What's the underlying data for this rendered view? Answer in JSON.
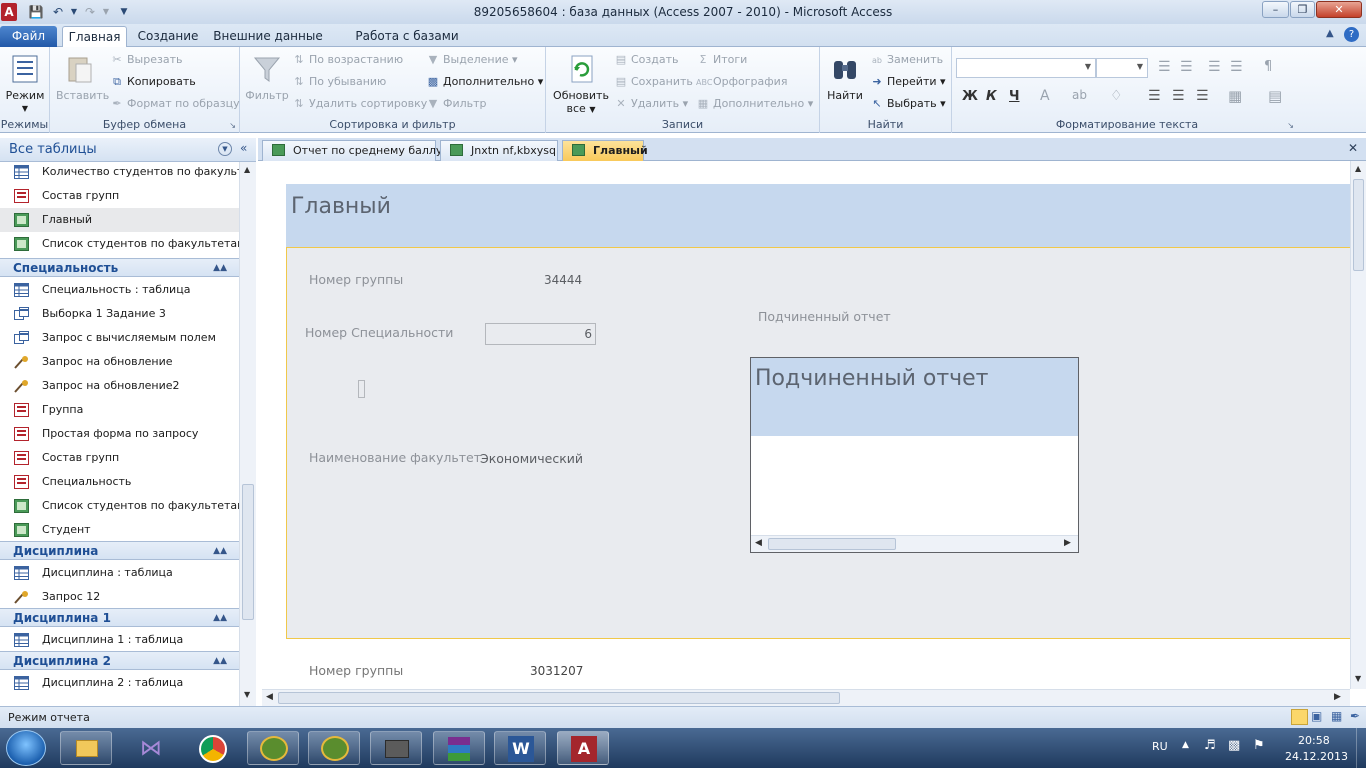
{
  "window": {
    "title": "89205658604 : база данных (Access 2007 - 2010)  -  Microsoft Access"
  },
  "ribbon_tabs": [
    "Файл",
    "Главная",
    "Создание",
    "Внешние данные",
    "Работа с базами данных"
  ],
  "ribbon": {
    "views": {
      "mode": "Режим",
      "group": "Режимы"
    },
    "clipboard": {
      "paste": "Вставить",
      "cut": "Вырезать",
      "copy": "Копировать",
      "format_painter": "Формат по образцу",
      "group": "Буфер обмена"
    },
    "sort_filter": {
      "filter": "Фильтр",
      "ascending": "По возрастанию",
      "descending": "По убыванию",
      "remove_sort": "Удалить сортировку",
      "selection": "Выделение",
      "advanced": "Дополнительно",
      "toggle_filter": "Фильтр",
      "group": "Сортировка и фильтр"
    },
    "records": {
      "refresh": "Обновить",
      "refresh2": "все",
      "new": "Создать",
      "save": "Сохранить",
      "delete": "Удалить",
      "totals": "Итоги",
      "spelling": "Орфография",
      "more": "Дополнительно",
      "group": "Записи"
    },
    "find": {
      "find": "Найти",
      "replace": "Заменить",
      "goto": "Перейти",
      "select": "Выбрать",
      "group": "Найти"
    },
    "text_format": {
      "bold": "Ж",
      "italic": "К",
      "underline": "Ч",
      "group": "Форматирование текста"
    }
  },
  "nav": {
    "header": "Все таблицы",
    "top_items": [
      "Количество студентов по факульт...",
      "Состав групп",
      "Главный",
      "Список студентов по факультетам..."
    ],
    "groups": [
      {
        "title": "Специальность",
        "items": [
          "Специальность : таблица",
          "Выборка 1 Задание 3",
          "Запрос с вычисляемым полем",
          "Запрос на обновление",
          "Запрос на обновление2",
          "Группа",
          "Простая форма по запросу",
          "Состав групп",
          "Специальность",
          "Список студентов по факультетам...",
          "Студент"
        ]
      },
      {
        "title": "Дисциплина",
        "items": [
          "Дисциплина : таблица",
          "Запрос 12"
        ]
      },
      {
        "title": "Дисциплина 1",
        "items": [
          "Дисциплина 1 : таблица"
        ]
      },
      {
        "title": "Дисциплина 2",
        "items": [
          "Дисциплина 2 : таблица"
        ]
      }
    ]
  },
  "doc_tabs": [
    "Отчет по среднему баллу",
    "Jnxtn nf,kbxysq",
    "Главный"
  ],
  "report": {
    "title": "Главный",
    "group_label": "Номер группы",
    "group_value": "34444",
    "spec_label": "Номер Специальности",
    "spec_value": "6",
    "faculty_label": "Наименование факультет",
    "faculty_value": "Экономический",
    "subreport_label": "Подчиненный отчет",
    "subreport_title": "Подчиненный отчет",
    "next_group_label": "Номер группы",
    "next_group_value": "3031207"
  },
  "status": {
    "text": "Режим отчета"
  },
  "tray": {
    "lang": "RU",
    "time": "20:58",
    "date": "24.12.2013"
  }
}
